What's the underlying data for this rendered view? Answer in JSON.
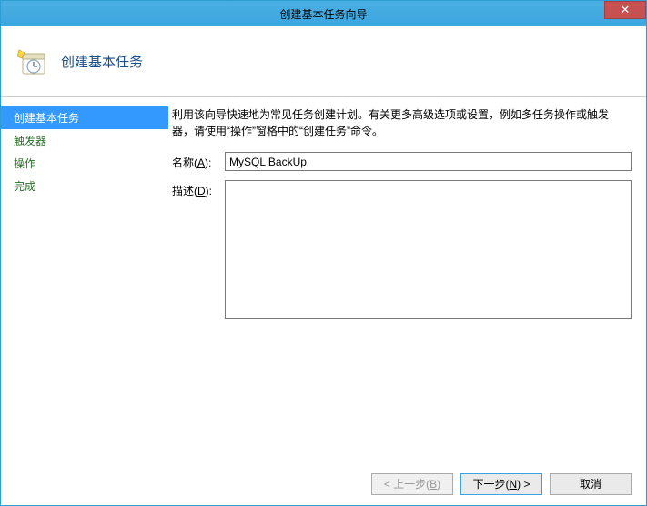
{
  "window": {
    "title": "创建基本任务向导",
    "close_glyph": "✕"
  },
  "header": {
    "heading": "创建基本任务"
  },
  "sidebar": {
    "steps": [
      {
        "label": "创建基本任务",
        "active": true
      },
      {
        "label": "触发器",
        "active": false
      },
      {
        "label": "操作",
        "active": false
      },
      {
        "label": "完成",
        "active": false
      }
    ]
  },
  "content": {
    "intro": "利用该向导快速地为常见任务创建计划。有关更多高级选项或设置，例如多任务操作或触发器，请使用“操作”窗格中的“创建任务”命令。",
    "name_label_pre": "名称(",
    "name_label_key": "A",
    "name_label_post": "):",
    "name_value": "MySQL BackUp",
    "desc_label_pre": "描述(",
    "desc_label_key": "D",
    "desc_label_post": "):",
    "desc_value": ""
  },
  "footer": {
    "back_pre": "< 上一步(",
    "back_key": "B",
    "back_post": ")",
    "next_pre": "下一步(",
    "next_key": "N",
    "next_post": ") >",
    "cancel": "取消"
  }
}
